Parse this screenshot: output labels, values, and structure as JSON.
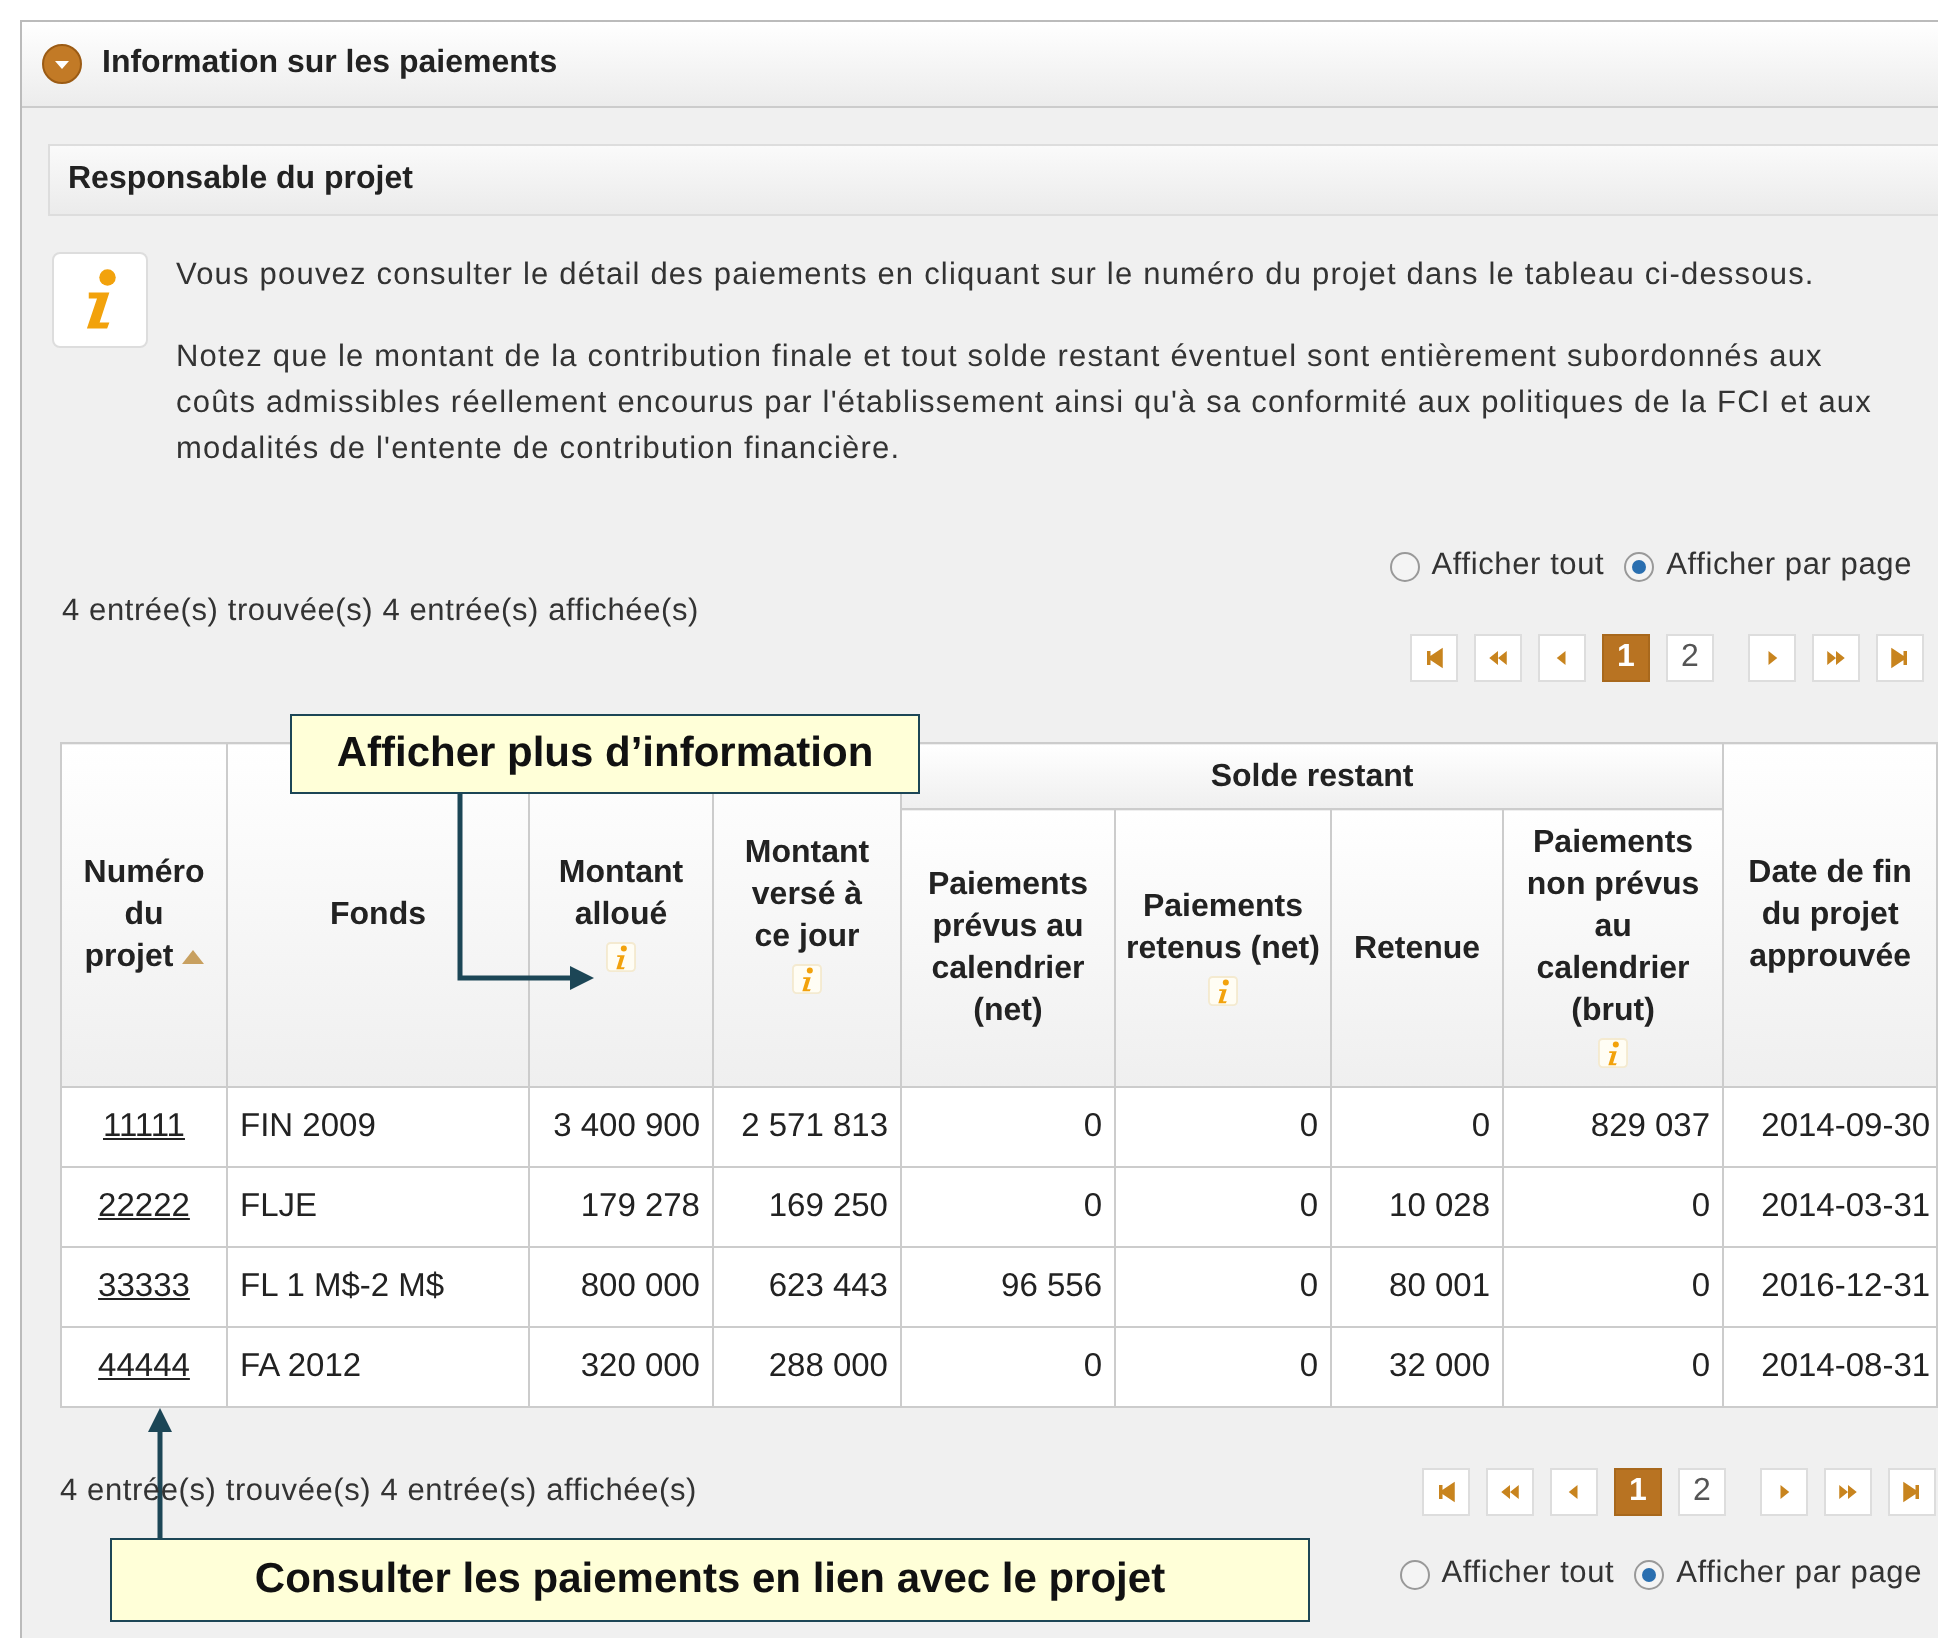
{
  "panel": {
    "title": "Information sur les paiements",
    "expanded": true
  },
  "section": {
    "title": "Responsable du projet"
  },
  "info": [
    "Vous pouvez consulter le détail des paiements en cliquant sur le numéro du projet dans le tableau ci-dessous.",
    "Notez que le montant de la contribution finale et tout solde restant éventuel sont entièrement subordonnés aux coûts admissibles réellement encourus par l'établissement ainsi qu'à sa conformité aux politiques de la FCI et aux modalités de l'entente de contribution financière."
  ],
  "top": {
    "view_options": [
      {
        "label": "Afficher tout",
        "selected": false
      },
      {
        "label": "Afficher par page",
        "selected": true
      }
    ],
    "count": "4 entrée(s) trouvée(s) 4 entrée(s) affichée(s)",
    "pagination": [
      {
        "kind": "first"
      },
      {
        "kind": "fast_back"
      },
      {
        "kind": "back"
      },
      {
        "kind": "page",
        "label": "1",
        "selected": true
      },
      {
        "kind": "page",
        "label": "2",
        "selected": false
      },
      {
        "kind": "forward"
      },
      {
        "kind": "fast_forward"
      },
      {
        "kind": "last"
      }
    ]
  },
  "table": {
    "group_header": {
      "label": "Solde restant"
    },
    "columns": [
      {
        "label": "Numéro du projet",
        "sorted": true
      },
      {
        "label": "Fonds"
      },
      {
        "label": "Montant alloué",
        "info": true
      },
      {
        "label": "Montant versé à ce jour",
        "info": true
      },
      {
        "label": "Paiements prévus au calendrier (net)",
        "group": true
      },
      {
        "label": "Paiements retenus (net)",
        "info": true,
        "group": true
      },
      {
        "label": "Retenue",
        "group": true
      },
      {
        "label": "Paiements non prévus au calendrier (brut)",
        "info": true,
        "group": true
      },
      {
        "label": "Date de fin du projet approuvée"
      }
    ],
    "rows": [
      {
        "cells": [
          "11111",
          "FIN 2009",
          "3 400 900",
          "2 571 813",
          "0",
          "0",
          "0",
          "829 037",
          "2014-09-30"
        ]
      },
      {
        "cells": [
          "22222",
          "FLJE",
          "179 278",
          "169 250",
          "0",
          "0",
          "10 028",
          "0",
          "2014-03-31"
        ]
      },
      {
        "cells": [
          "33333",
          "FL 1 M$-2 M$",
          "800 000",
          "623 443",
          "96 556",
          "0",
          "80 001",
          "0",
          "2016-12-31"
        ]
      },
      {
        "cells": [
          "44444",
          "FA 2012",
          "320 000",
          "288 000",
          "0",
          "0",
          "32 000",
          "0",
          "2014-08-31"
        ]
      }
    ]
  },
  "bottom": {
    "count": "4 entrée(s) trouvée(s) 4 entrée(s) affichée(s)",
    "pagination": [
      {
        "kind": "first"
      },
      {
        "kind": "fast_back"
      },
      {
        "kind": "back"
      },
      {
        "kind": "page",
        "label": "1",
        "selected": true
      },
      {
        "kind": "page",
        "label": "2",
        "selected": false
      },
      {
        "kind": "forward"
      },
      {
        "kind": "fast_forward"
      },
      {
        "kind": "last"
      }
    ],
    "view_options": [
      {
        "label": "Afficher tout",
        "selected": false
      },
      {
        "label": "Afficher par page",
        "selected": true
      }
    ]
  },
  "callouts": [
    "Afficher plus d’information",
    "Consulter les paiements en lien avec le projet"
  ]
}
